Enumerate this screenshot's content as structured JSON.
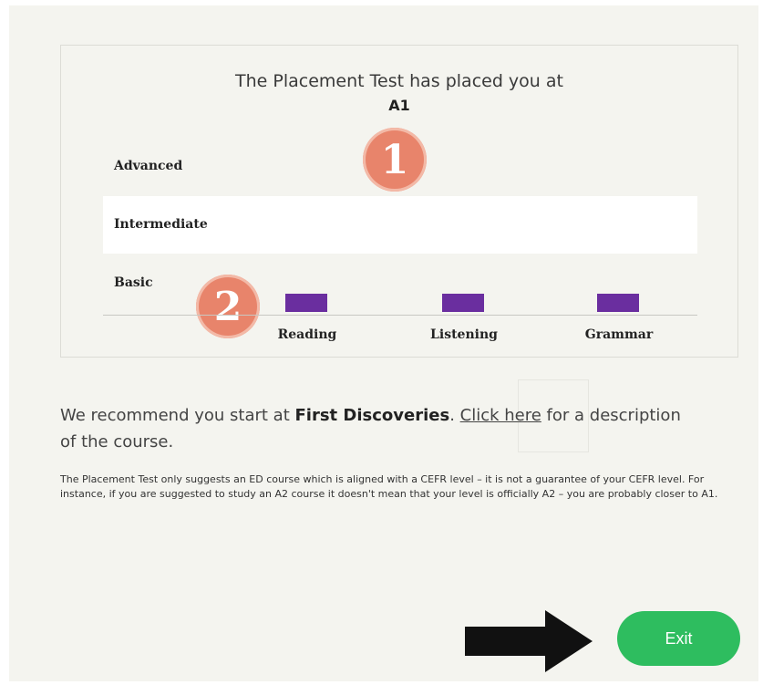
{
  "result": {
    "heading": "The Placement Test has placed you at",
    "level": "A1",
    "bands": {
      "advanced": "Advanced",
      "intermediate": "Intermediate",
      "basic": "Basic"
    },
    "skills": [
      {
        "label": "Reading",
        "band": "Basic"
      },
      {
        "label": "Listening",
        "band": "Basic"
      },
      {
        "label": "Grammar",
        "band": "Basic"
      }
    ],
    "bar_color": "#6a2e9f",
    "markers": [
      "1",
      "2"
    ]
  },
  "recommendation": {
    "prefix": "We recommend you start at ",
    "course": "First Discoveries",
    "period": ". ",
    "link_label": "Click here",
    "suffix": " for a description of the course."
  },
  "disclaimer": "The Placement Test only suggests an ED course which is aligned with a CEFR level – it is not a guarantee of your CEFR level. For instance, if you are suggested to study an A2 course it doesn't mean that your level is officially A2 – you are probably closer to A1.",
  "exit_label": "Exit",
  "colors": {
    "exit_button": "#2ebd5f",
    "marker": "#e8846b",
    "background": "#f4f4ef"
  }
}
